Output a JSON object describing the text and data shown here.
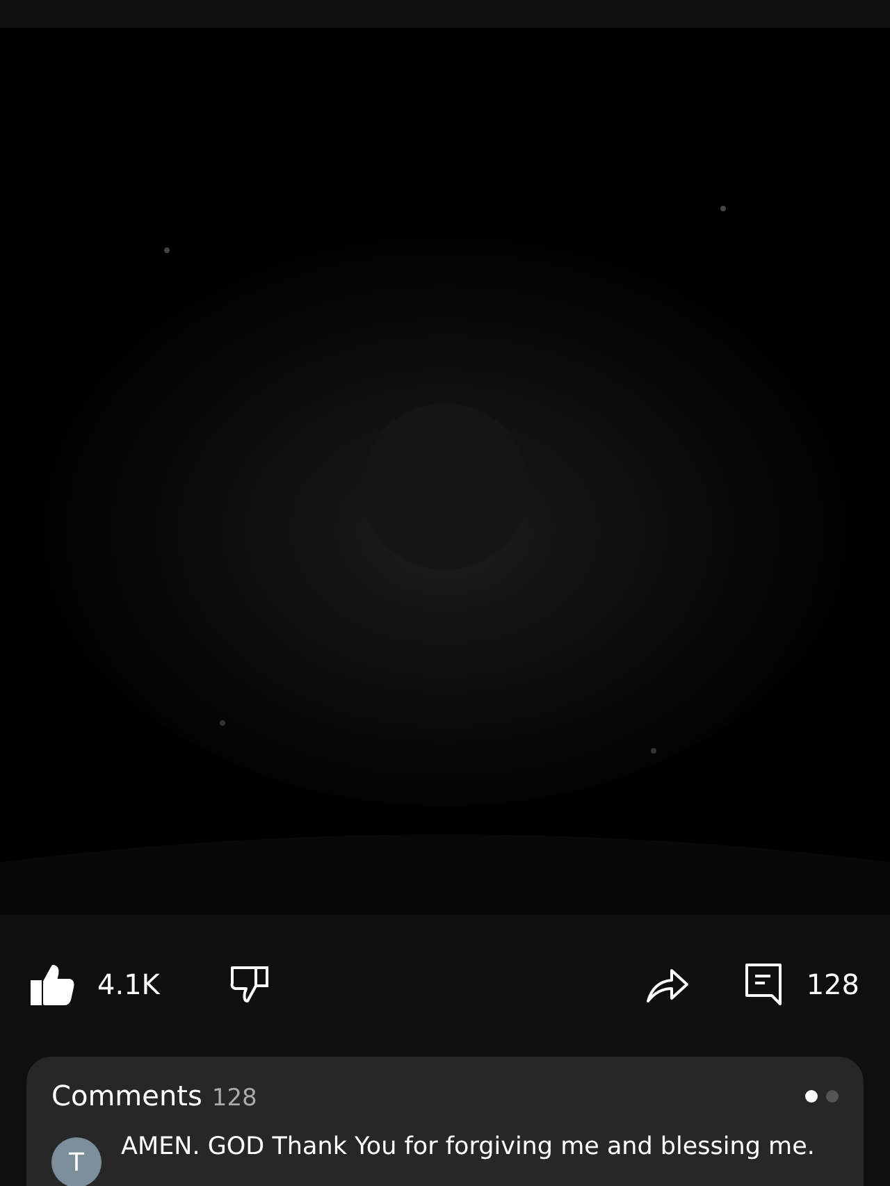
{
  "actions": {
    "likes": "4.1K",
    "liked": true,
    "comments_count": "128"
  },
  "comments": {
    "title": "Comments",
    "count": "128",
    "pages": [
      {
        "selected": true
      },
      {
        "selected": false
      }
    ],
    "items": [
      {
        "avatar": "T",
        "text": "AMEN. GOD Thank You for forgiving me and blessing me."
      }
    ]
  }
}
